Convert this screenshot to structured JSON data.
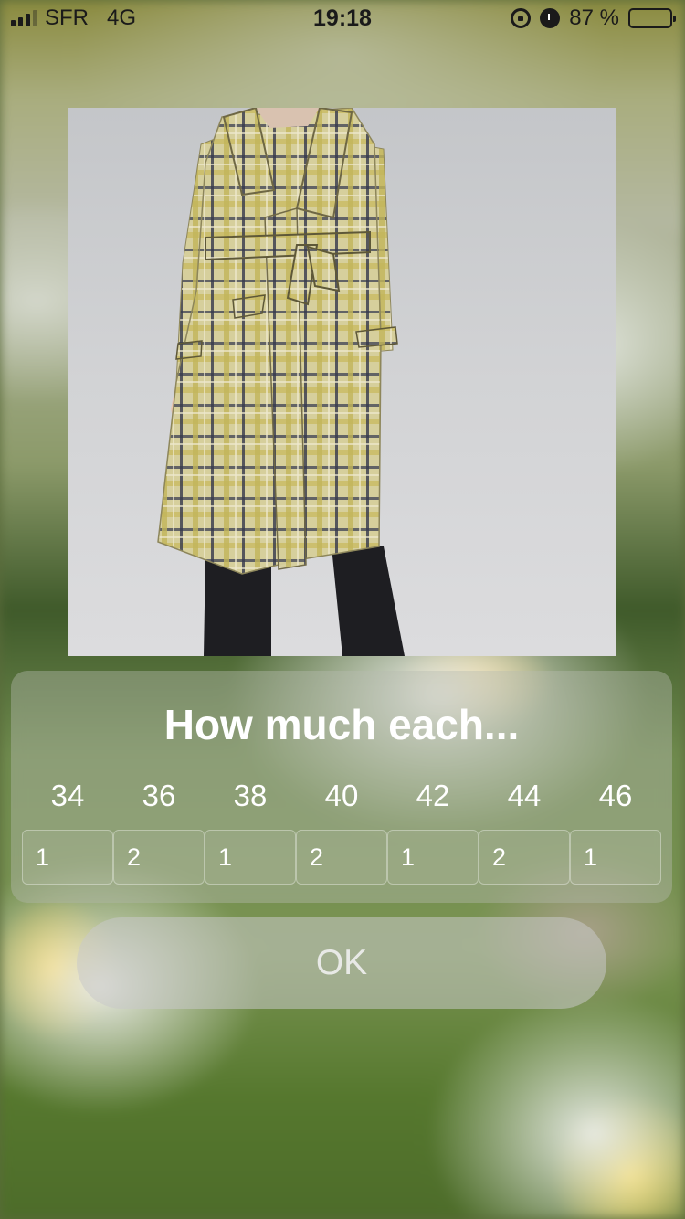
{
  "status_bar": {
    "carrier": "SFR",
    "network": "4G",
    "time": "19:18",
    "battery_percent": "87 %",
    "battery_level": 0.87,
    "icons": [
      "signal-icon",
      "orientation-lock-icon",
      "alarm-icon",
      "battery-icon"
    ]
  },
  "product": {
    "image_description_icon": "product-photo"
  },
  "panel": {
    "title": "How much each...",
    "sizes": [
      "34",
      "36",
      "38",
      "40",
      "42",
      "44",
      "46"
    ],
    "quantities": [
      "1",
      "2",
      "1",
      "2",
      "1",
      "2",
      "1"
    ]
  },
  "ok_button": {
    "label": "OK"
  }
}
